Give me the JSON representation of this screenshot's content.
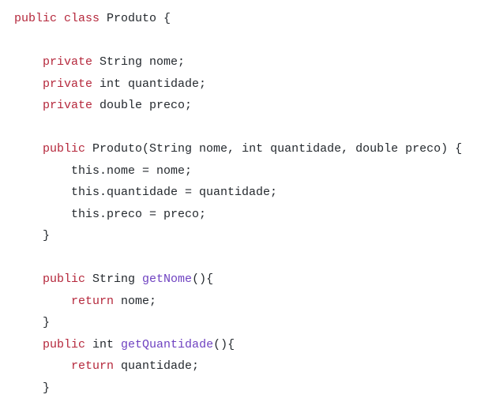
{
  "colors": {
    "keyword": "#b5283c",
    "function": "#6f42c1",
    "text": "#24292e"
  },
  "lines": [
    [
      [
        "kw",
        "public class"
      ],
      [
        "tx",
        " Produto {"
      ]
    ],
    [],
    [
      [
        "tx",
        "    "
      ],
      [
        "kw",
        "private"
      ],
      [
        "tx",
        " String nome;"
      ]
    ],
    [
      [
        "tx",
        "    "
      ],
      [
        "kw",
        "private"
      ],
      [
        "tx",
        " int quantidade;"
      ]
    ],
    [
      [
        "tx",
        "    "
      ],
      [
        "kw",
        "private"
      ],
      [
        "tx",
        " double preco;"
      ]
    ],
    [],
    [
      [
        "tx",
        "    "
      ],
      [
        "kw",
        "public"
      ],
      [
        "tx",
        " Produto(String nome, int quantidade, double preco) {"
      ]
    ],
    [
      [
        "tx",
        "        this.nome = nome;"
      ]
    ],
    [
      [
        "tx",
        "        this.quantidade = quantidade;"
      ]
    ],
    [
      [
        "tx",
        "        this.preco = preco;"
      ]
    ],
    [
      [
        "tx",
        "    }"
      ]
    ],
    [],
    [
      [
        "tx",
        "    "
      ],
      [
        "kw",
        "public"
      ],
      [
        "tx",
        " String "
      ],
      [
        "fn",
        "getNome"
      ],
      [
        "tx",
        "(){"
      ]
    ],
    [
      [
        "tx",
        "        "
      ],
      [
        "kw",
        "return"
      ],
      [
        "tx",
        " nome;"
      ]
    ],
    [
      [
        "tx",
        "    }"
      ]
    ],
    [
      [
        "tx",
        "    "
      ],
      [
        "kw",
        "public"
      ],
      [
        "tx",
        " int "
      ],
      [
        "fn",
        "getQuantidade"
      ],
      [
        "tx",
        "(){"
      ]
    ],
    [
      [
        "tx",
        "        "
      ],
      [
        "kw",
        "return"
      ],
      [
        "tx",
        " quantidade;"
      ]
    ],
    [
      [
        "tx",
        "    }"
      ]
    ]
  ]
}
